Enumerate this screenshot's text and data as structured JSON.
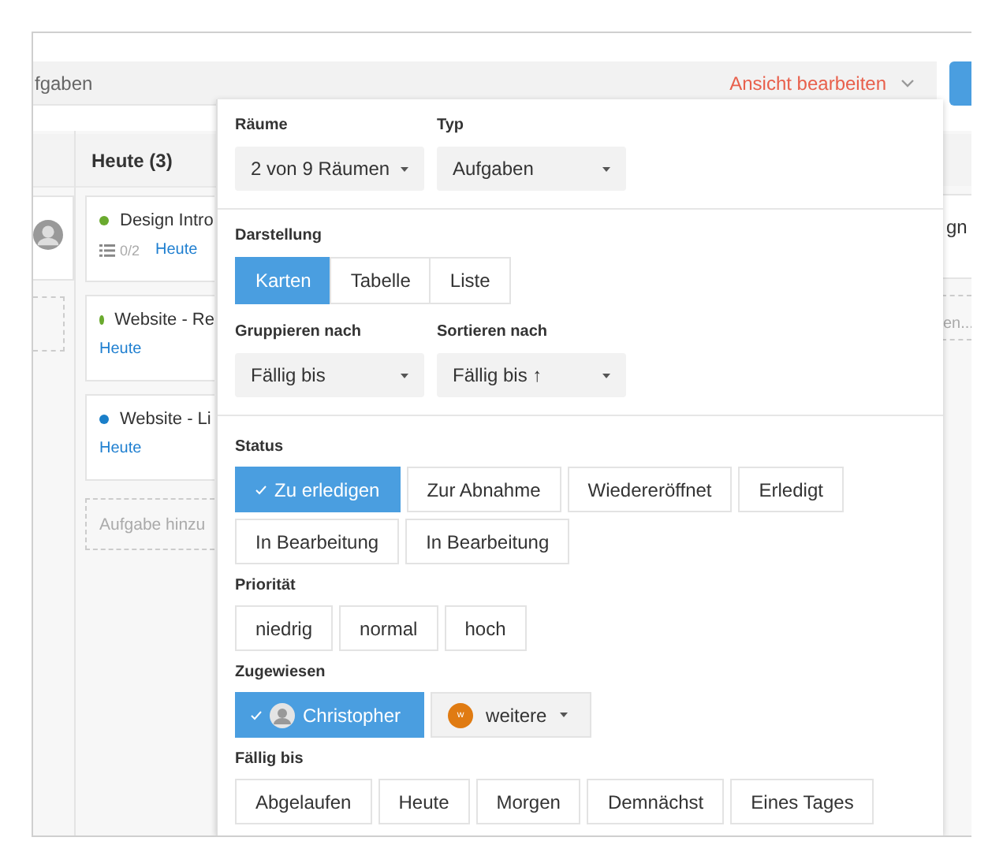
{
  "search": {
    "value": "fgaben",
    "edit_view": "Ansicht bearbeiten"
  },
  "column": {
    "title": "Heute (3)",
    "cards": [
      {
        "title": "Design Intro",
        "color": "#6aaa2e",
        "checklist": "0/2",
        "due": "Heute"
      },
      {
        "title": "Website - Re",
        "color": "#6aaa2e",
        "due": "Heute"
      },
      {
        "title": "Website - Li",
        "color": "#1a7fc9",
        "due": "Heute"
      }
    ],
    "add_task": "Aufgabe hinzu"
  },
  "right_column": {
    "card_text": "gn",
    "add_task": "en..."
  },
  "panel": {
    "selects": [
      {
        "label": "Räume",
        "value": "2 von 9 Räumen"
      },
      {
        "label": "Typ",
        "value": "Aufgaben"
      }
    ],
    "display": {
      "label": "Darstellung",
      "options": [
        {
          "label": "Karten",
          "selected": true
        },
        {
          "label": "Tabelle",
          "selected": false
        },
        {
          "label": "Liste",
          "selected": false
        }
      ]
    },
    "sorting": [
      {
        "label": "Gruppieren nach",
        "value": "Fällig bis"
      },
      {
        "label": "Sortieren nach",
        "value": "Fällig bis ↑"
      }
    ],
    "filters": [
      {
        "label": "Status",
        "options": [
          {
            "kind": "chip",
            "label": "Zu erledigen",
            "selected": true
          },
          {
            "kind": "chip",
            "label": "Zur Abnahme",
            "selected": false
          },
          {
            "kind": "chip",
            "label": "Wiedereröffnet",
            "selected": false
          },
          {
            "kind": "chip",
            "label": "Erledigt",
            "selected": false
          },
          {
            "kind": "chip",
            "label": "In Bearbeitung",
            "selected": false
          },
          {
            "kind": "chip",
            "label": "In Bearbeitung",
            "selected": false
          }
        ]
      },
      {
        "label": "Priorität",
        "options": [
          {
            "kind": "chip",
            "label": "niedrig",
            "selected": false
          },
          {
            "kind": "chip",
            "label": "normal",
            "selected": false
          },
          {
            "kind": "chip",
            "label": "hoch",
            "selected": false
          }
        ]
      },
      {
        "label": "Zugewiesen",
        "options": [
          {
            "kind": "person",
            "label": "Christopher",
            "selected": true
          },
          {
            "kind": "more",
            "initial": "w",
            "label": "weitere"
          }
        ]
      },
      {
        "label": "Fällig bis",
        "options": [
          {
            "kind": "chip",
            "label": "Abgelaufen",
            "selected": false
          },
          {
            "kind": "chip",
            "label": "Heute",
            "selected": false
          },
          {
            "kind": "chip",
            "label": "Morgen",
            "selected": false
          },
          {
            "kind": "chip",
            "label": "Demnächst",
            "selected": false
          },
          {
            "kind": "chip",
            "label": "Eines Tages",
            "selected": false
          }
        ]
      }
    ]
  }
}
